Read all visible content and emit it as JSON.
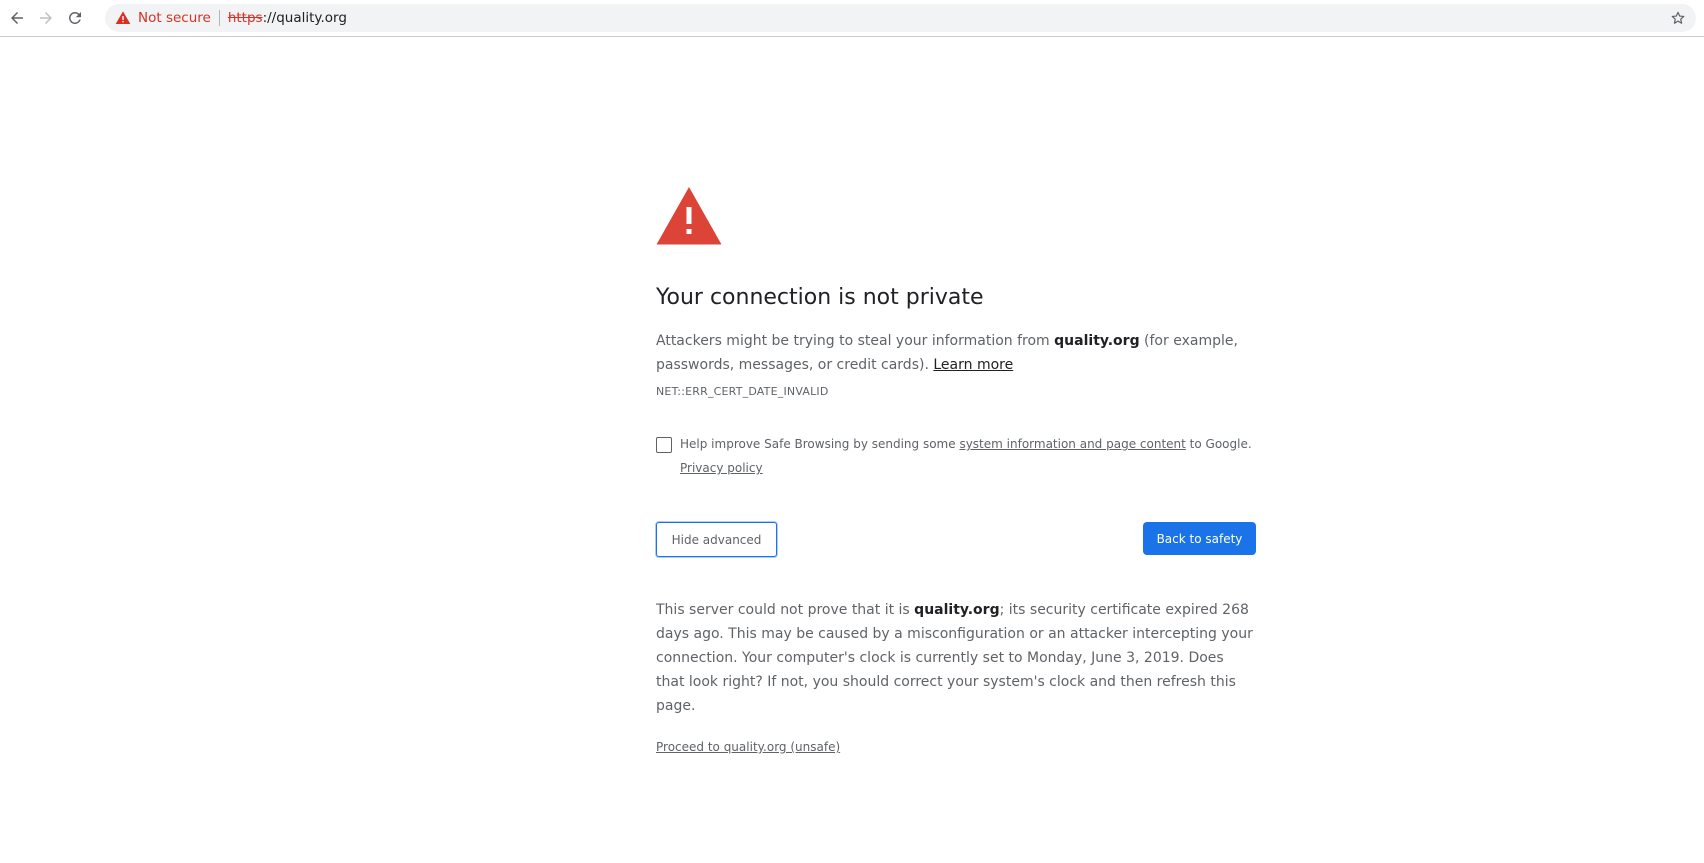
{
  "browser": {
    "back_icon": "arrow-left-icon",
    "forward_icon": "arrow-right-icon",
    "reload_icon": "reload-icon",
    "security_chip": {
      "icon": "warning-triangle-icon",
      "label": "Not secure"
    },
    "url": {
      "scheme": "https",
      "rest": "://quality.org"
    },
    "bookmark_icon": "star-icon"
  },
  "interstitial": {
    "icon": "warning-triangle-icon",
    "title": "Your connection is not private",
    "explanation": {
      "part1": "Attackers might be trying to steal your information from ",
      "domain": "quality.org",
      "part2": " (for example, passwords, messages, or credit cards). ",
      "learn_more": "Learn more"
    },
    "error_code": "NET::ERR_CERT_DATE_INVALID",
    "safe_browsing": {
      "checked": false,
      "part1": "Help improve Safe Browsing by sending some ",
      "link": "system information and page content",
      "part2": " to Google. ",
      "privacy_link": "Privacy policy"
    },
    "buttons": {
      "hide_advanced": "Hide advanced",
      "back_to_safety": "Back to safety"
    },
    "details": {
      "part1": "This server could not prove that it is ",
      "domain": "quality.org",
      "part2": "; its security certificate expired 268 days ago. This may be caused by a misconfiguration or an attacker intercepting your connection. Your computer's clock is currently set to Monday, June 3, 2019. Does that look right? If not, you should correct your system's clock and then refresh this page."
    },
    "proceed_link": "Proceed to quality.org (unsafe)"
  },
  "colors": {
    "danger": "#d93025",
    "primary": "#1a73e8",
    "warning_icon": "#db4437",
    "text_secondary": "#5f6368",
    "text_primary": "#202124"
  }
}
